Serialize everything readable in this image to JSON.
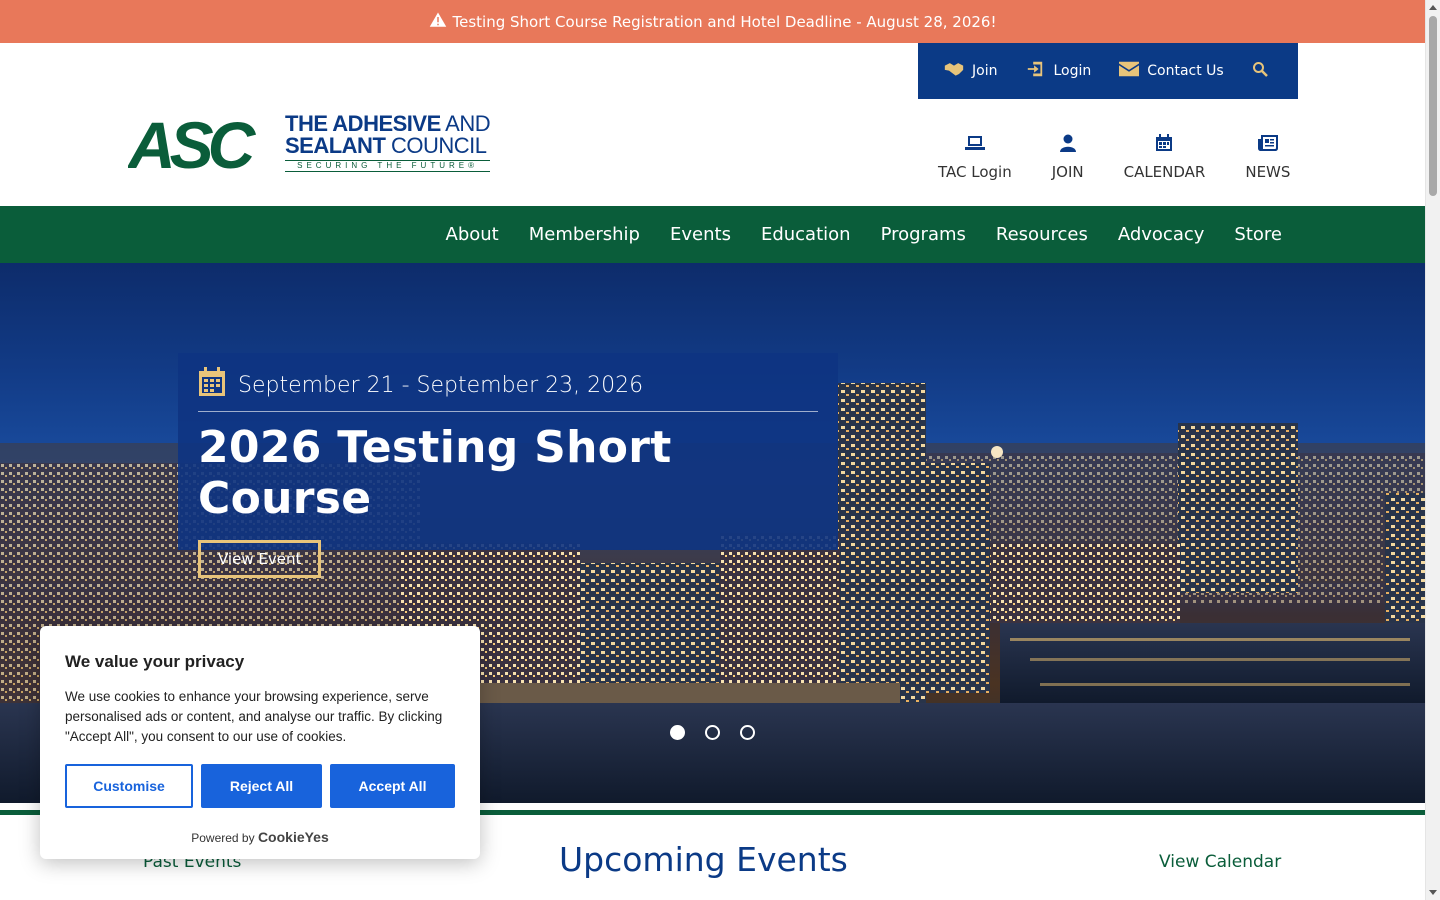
{
  "alert": {
    "text": "Testing Short Course Registration and Hotel Deadline  - August 28, 2026!",
    "icon": "warning-icon"
  },
  "utility": [
    {
      "label": "Join",
      "icon": "handshake-icon"
    },
    {
      "label": "Login",
      "icon": "login-icon"
    },
    {
      "label": "Contact Us",
      "icon": "envelope-icon"
    }
  ],
  "logo": {
    "abbr": "ASC",
    "line1_bold": "THE ADHESIVE",
    "line1_thin": " AND",
    "line2_bold": "SEALANT",
    "line2_thin": " COUNCIL",
    "tagline": "SECURING THE FUTURE®"
  },
  "quick_links": [
    {
      "label": "TAC Login",
      "icon": "laptop-icon"
    },
    {
      "label": "JOIN",
      "icon": "user-icon"
    },
    {
      "label": "CALENDAR",
      "icon": "calendar-icon"
    },
    {
      "label": "NEWS",
      "icon": "newspaper-icon"
    }
  ],
  "nav": [
    "About",
    "Membership",
    "Events",
    "Education",
    "Programs",
    "Resources",
    "Advocacy",
    "Store"
  ],
  "hero": {
    "date": "September 21 - September 23, 2026",
    "title": "2026 Testing Short Course",
    "button": "View Event",
    "slides": 3,
    "active_slide": 1
  },
  "events_section": {
    "past_link": "Past Events",
    "heading": "Upcoming Events",
    "calendar_link": "View Calendar"
  },
  "cookie": {
    "title": "We value your privacy",
    "body": "We use cookies to enhance your browsing experience, serve personalised ads or content, and analyse our traffic. By clicking \"Accept All\", you consent to our use of cookies.",
    "customise": "Customise",
    "reject": "Reject All",
    "accept": "Accept All",
    "powered_prefix": "Powered by",
    "powered_brand": "CookieYes"
  },
  "colors": {
    "alert": "#e8785a",
    "navy": "#0b3a86",
    "green": "#0a5d3a",
    "gold": "#e8c47a",
    "cookie_blue": "#1863dc"
  }
}
